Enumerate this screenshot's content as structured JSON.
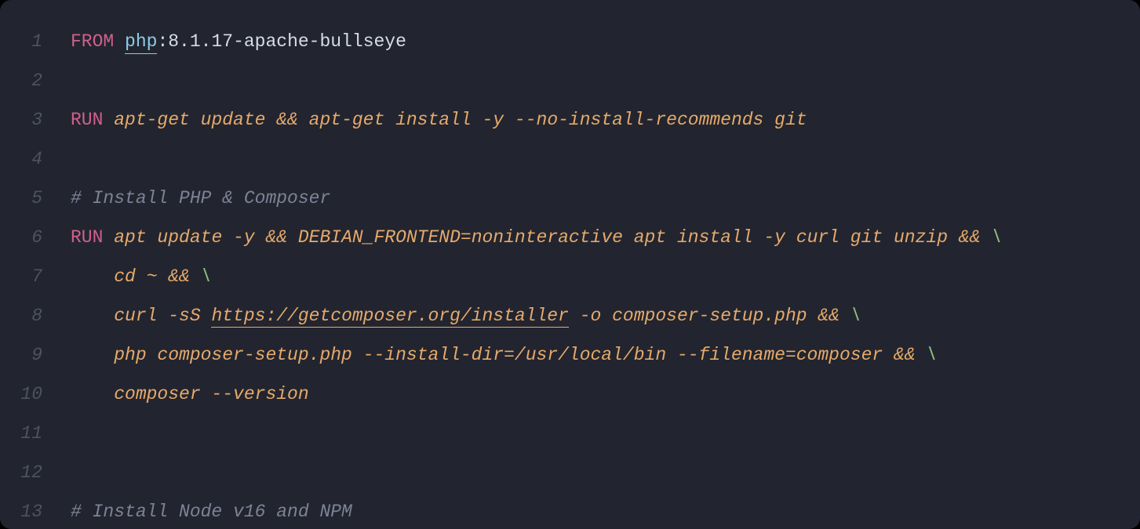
{
  "lines": [
    {
      "num": "1",
      "tokens": [
        {
          "cls": "tok-keyword",
          "text": "FROM"
        },
        {
          "cls": "tok-plain",
          "text": " "
        },
        {
          "cls": "tok-link",
          "text": "php"
        },
        {
          "cls": "tok-plain",
          "text": ":8.1.17-apache-bullseye"
        }
      ]
    },
    {
      "num": "2",
      "tokens": []
    },
    {
      "num": "3",
      "tokens": [
        {
          "cls": "tok-keyword",
          "text": "RUN"
        },
        {
          "cls": "tok-arg",
          "text": " apt-get update && apt-get install -y --no-install-recommends git"
        }
      ]
    },
    {
      "num": "4",
      "tokens": []
    },
    {
      "num": "5",
      "tokens": [
        {
          "cls": "tok-comment",
          "text": "# Install PHP & Composer"
        }
      ]
    },
    {
      "num": "6",
      "tokens": [
        {
          "cls": "tok-keyword",
          "text": "RUN"
        },
        {
          "cls": "tok-arg",
          "text": " apt update -y && DEBIAN_FRONTEND=noninteractive apt install -y curl git unzip && "
        },
        {
          "cls": "tok-cont",
          "text": "\\"
        }
      ]
    },
    {
      "num": "7",
      "tokens": [
        {
          "cls": "tok-arg",
          "text": "    cd ~ && "
        },
        {
          "cls": "tok-cont",
          "text": "\\"
        }
      ]
    },
    {
      "num": "8",
      "tokens": [
        {
          "cls": "tok-arg",
          "text": "    curl -sS "
        },
        {
          "cls": "tok-url",
          "text": "https://getcomposer.org/installer"
        },
        {
          "cls": "tok-arg",
          "text": " -o composer-setup.php && "
        },
        {
          "cls": "tok-cont",
          "text": "\\"
        }
      ]
    },
    {
      "num": "9",
      "tokens": [
        {
          "cls": "tok-arg",
          "text": "    php composer-setup.php --install-dir=/usr/local/bin --filename=composer && "
        },
        {
          "cls": "tok-cont",
          "text": "\\"
        }
      ]
    },
    {
      "num": "10",
      "tokens": [
        {
          "cls": "tok-arg",
          "text": "    composer --version"
        }
      ]
    },
    {
      "num": "11",
      "tokens": []
    },
    {
      "num": "12",
      "tokens": []
    },
    {
      "num": "13",
      "tokens": [
        {
          "cls": "tok-comment",
          "text": "# Install Node v16 and NPM"
        }
      ]
    }
  ]
}
